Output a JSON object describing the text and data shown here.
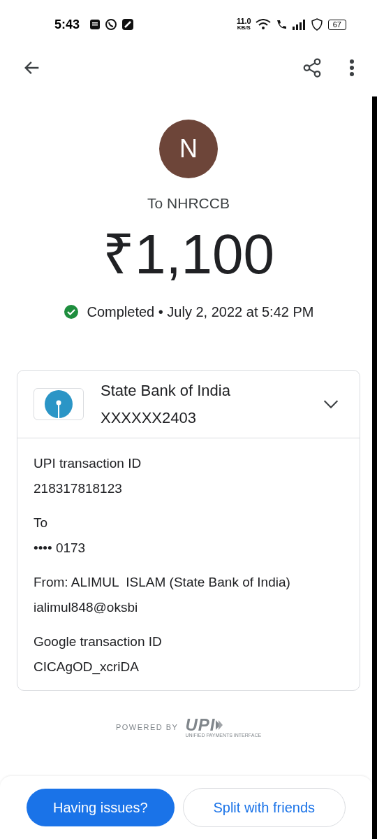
{
  "status_bar": {
    "time": "5:43",
    "speed": "11.0",
    "speed_unit": "KB/S",
    "battery": "67"
  },
  "payee": {
    "initial": "N",
    "title": "To NHRCCB"
  },
  "amount": "₹1,100",
  "status": {
    "completed": true,
    "text": "Completed • July 2, 2022 at 5:42 PM"
  },
  "account": {
    "bank": "State Bank of India",
    "number": "XXXXXX2403",
    "expanded": true
  },
  "details": [
    {
      "label": "UPI transaction ID",
      "value": "218317818123"
    },
    {
      "label": "To",
      "value": "•••• 0173"
    },
    {
      "label": "From: ALIMUL  ISLAM (State Bank of India)",
      "value": "ialimul848@oksbi"
    },
    {
      "label": "Google transaction ID",
      "value": "CICAgOD_xcriDA"
    }
  ],
  "powered_by": {
    "text": "POWERED BY",
    "logo": "UPI",
    "logo_sub": "UNIFIED PAYMENTS INTERFACE"
  },
  "buttons": [
    {
      "label": "Having issues?",
      "kind": "primary"
    },
    {
      "label": "Split with friends",
      "kind": "outline"
    }
  ]
}
